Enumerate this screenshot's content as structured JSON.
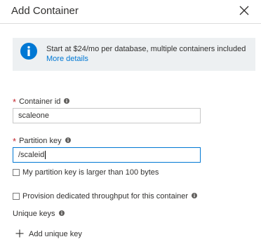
{
  "header": {
    "title": "Add Container"
  },
  "banner": {
    "message": "Start at $24/mo per database, multiple containers included",
    "link": "More details",
    "accent": "#0078d4"
  },
  "form": {
    "container_id": {
      "label": "Container id",
      "value": "scaleone",
      "required": true
    },
    "partition_key": {
      "label": "Partition key",
      "value": "/scaleid",
      "required": true
    },
    "large_partition_checkbox": {
      "label": "My partition key is larger than 100 bytes",
      "checked": false
    },
    "throughput_checkbox": {
      "label": "Provision dedicated throughput for this container",
      "checked": false
    },
    "unique_keys": {
      "label": "Unique keys",
      "add_label": "Add unique key"
    }
  },
  "icons": {
    "close": "close-icon",
    "info": "info-icon",
    "plus": "plus-icon"
  }
}
